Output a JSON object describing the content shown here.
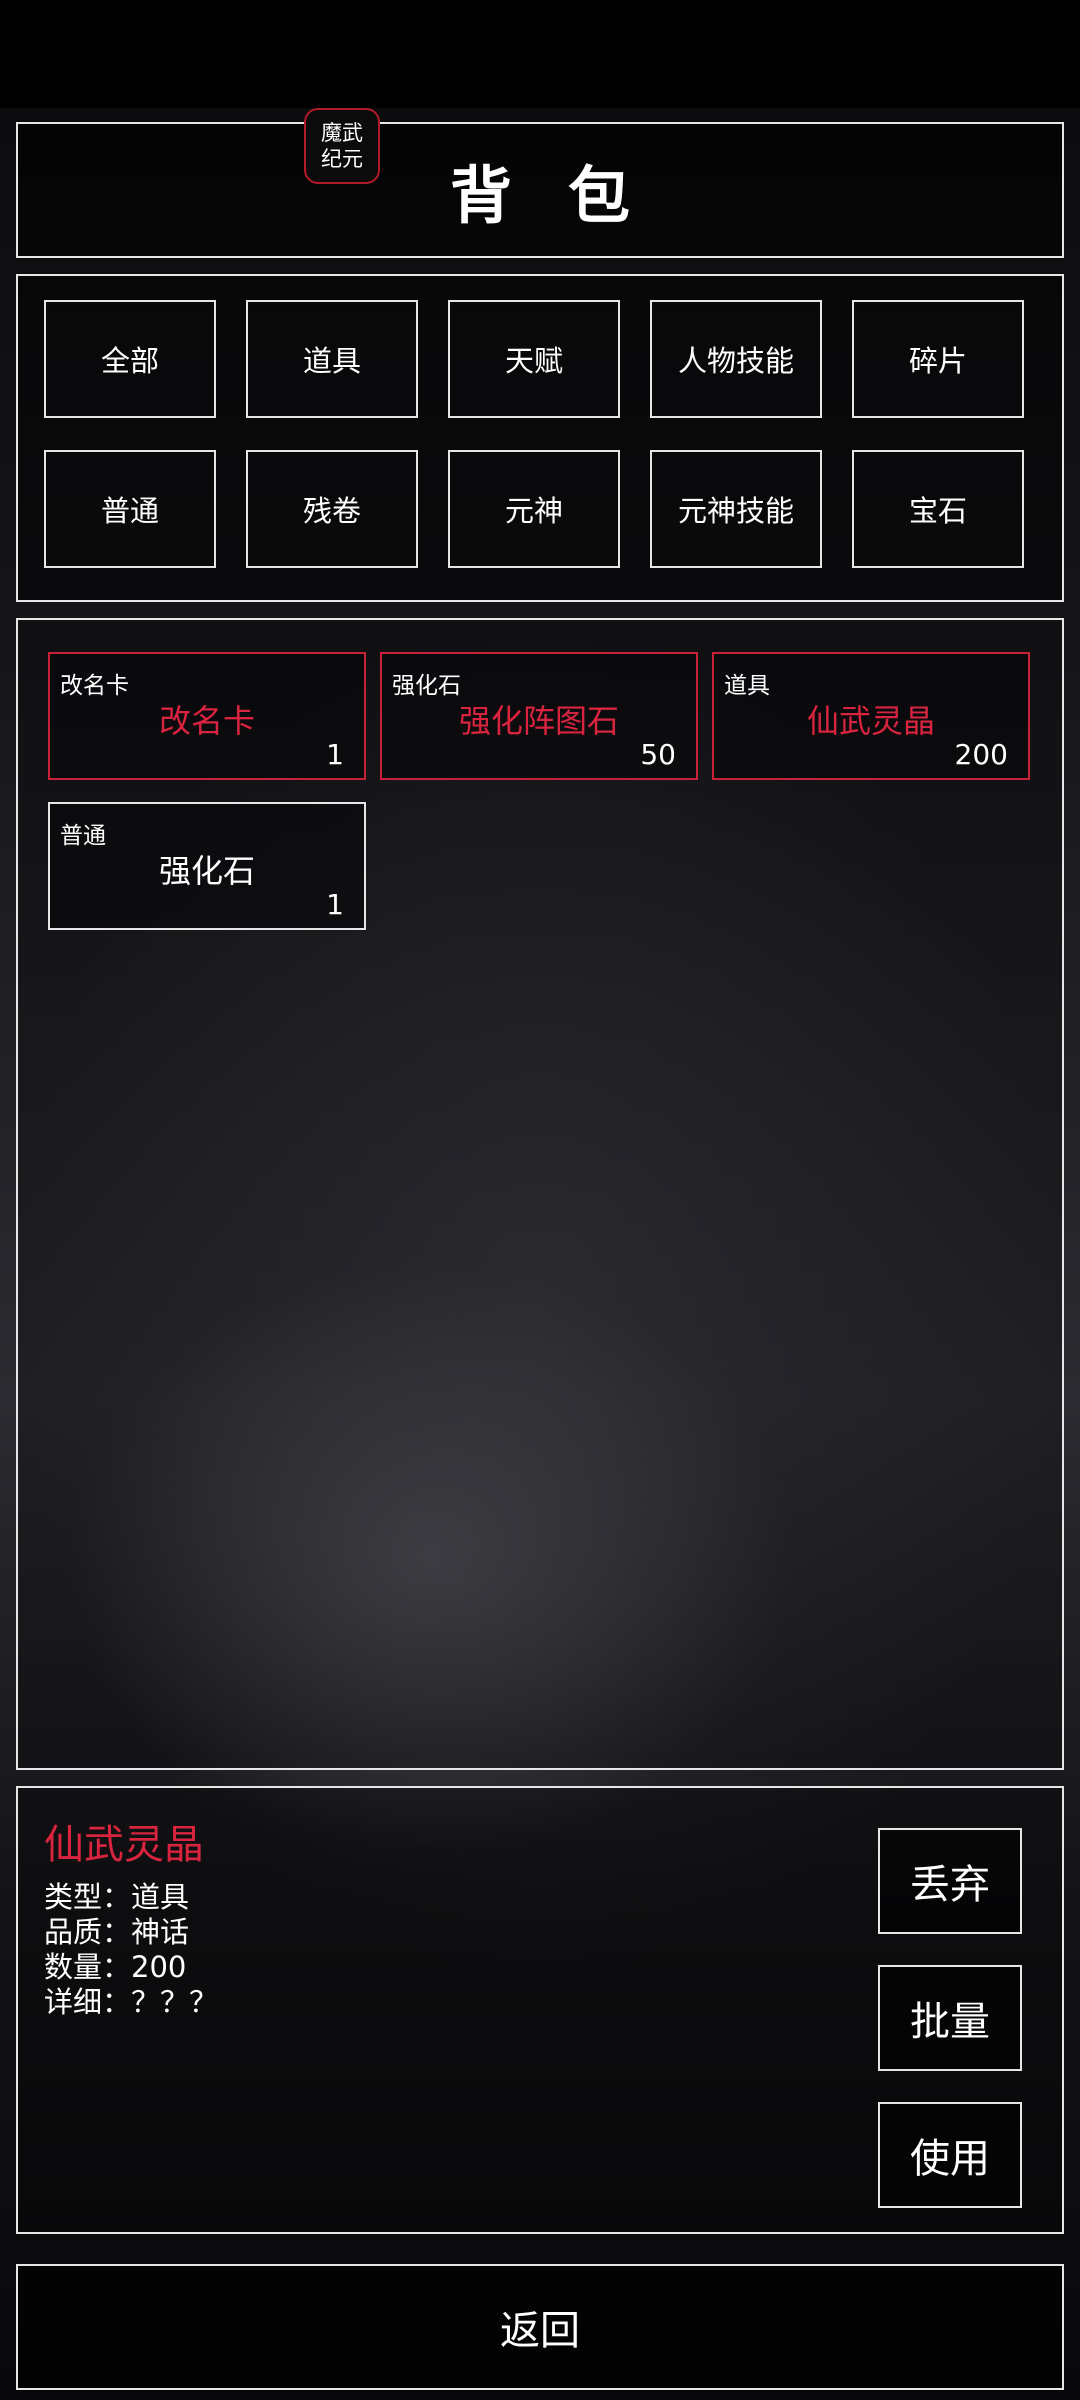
{
  "header": {
    "title": "背包",
    "logo_text": [
      "魔武",
      "纪元"
    ]
  },
  "tabs": [
    {
      "label": "全部"
    },
    {
      "label": "道具"
    },
    {
      "label": "天赋"
    },
    {
      "label": "人物技能"
    },
    {
      "label": "碎片"
    },
    {
      "label": "普通"
    },
    {
      "label": "残卷"
    },
    {
      "label": "元神"
    },
    {
      "label": "元神技能"
    },
    {
      "label": "宝石"
    }
  ],
  "items": [
    {
      "type": "改名卡",
      "name": "改名卡",
      "qty": "1",
      "quality_color": "#d8243e"
    },
    {
      "type": "强化石",
      "name": "强化阵图石",
      "qty": "50",
      "quality_color": "#d8243e"
    },
    {
      "type": "道具",
      "name": "仙武灵晶",
      "qty": "200",
      "quality_color": "#d8243e"
    },
    {
      "type": "普通",
      "name": "强化石",
      "qty": "1",
      "quality_color": "#ffffff"
    }
  ],
  "detail": {
    "name": "仙武灵晶",
    "type_line": "类型：道具",
    "quality_line": "品质：神话",
    "count_line": "数量：200",
    "info_line": "详细：？？？"
  },
  "actions": {
    "discard": "丢弃",
    "batch": "批量",
    "use": "使用"
  },
  "footer": {
    "back": "返回"
  },
  "colors": {
    "accent_red": "#d8243e",
    "border": "#e6e6e6"
  }
}
